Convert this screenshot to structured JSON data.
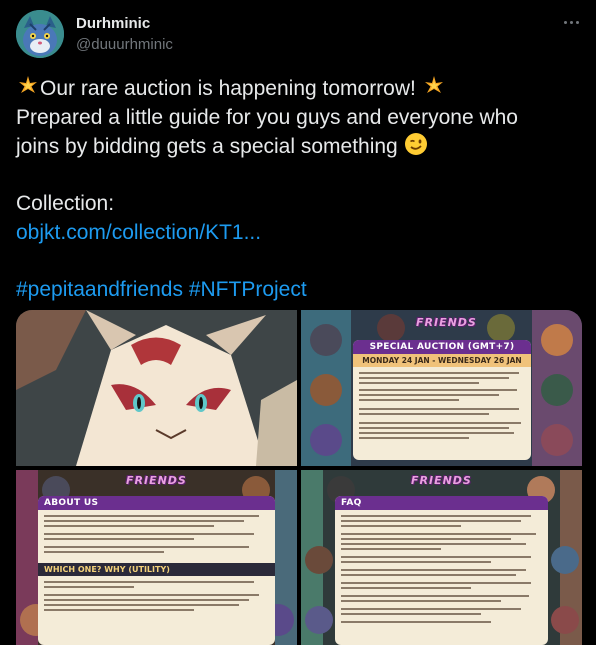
{
  "author": {
    "display_name": "Durhminic",
    "handle": "@duuurhminic"
  },
  "tweet": {
    "line1": "Our rare auction is happening tomorrow!",
    "line2": "Prepared a little guide for you guys and everyone who",
    "line3": "joins by bidding gets a special something",
    "collection_label": "Collection:",
    "collection_link": "objkt.com/collection/KT1...",
    "hashtag1": "#pepitaandfriends",
    "hashtag2": "#NFTProject"
  },
  "icons": {
    "sparkle": "glowing-star-emoji",
    "wink": "winking-face-emoji",
    "more": "more-options-icon"
  },
  "media": {
    "logo_text": "FRIENDS",
    "panel2": {
      "heading": "SPECIAL AUCTION (GMT+7)",
      "date": "MONDAY 24 JAN - WEDNESDAY 26 JAN"
    },
    "panel3": {
      "heading": "ABOUT US",
      "subheading": "WHICH ONE? WHY (UTILITY)"
    },
    "panel4": {
      "heading": "FAQ"
    }
  },
  "colors": {
    "link": "#1d9bf0",
    "background": "#000000",
    "text": "#e7e9ea",
    "muted": "#71767b",
    "card_header": "#6b2f8f"
  }
}
